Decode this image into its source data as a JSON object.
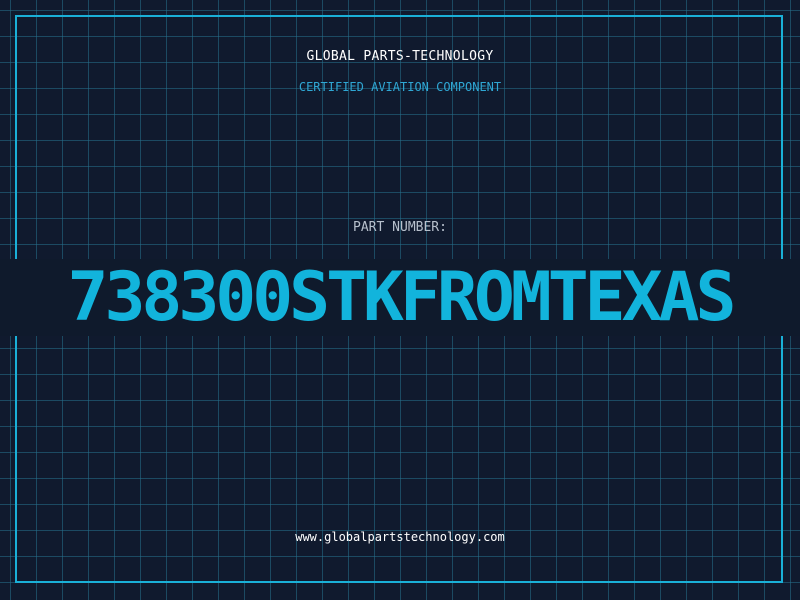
{
  "header": {
    "company": "GLOBAL PARTS-TECHNOLOGY",
    "subtitle": "CERTIFIED AVIATION COMPONENT"
  },
  "part": {
    "label": "PART NUMBER:",
    "number": "738300STKFROMTEXAS"
  },
  "footer": {
    "url": "www.globalpartstechnology.com"
  },
  "colors": {
    "background": "#101a2e",
    "grid": "#26708c",
    "accent": "#12b4dc",
    "border": "#1ab0d8"
  }
}
